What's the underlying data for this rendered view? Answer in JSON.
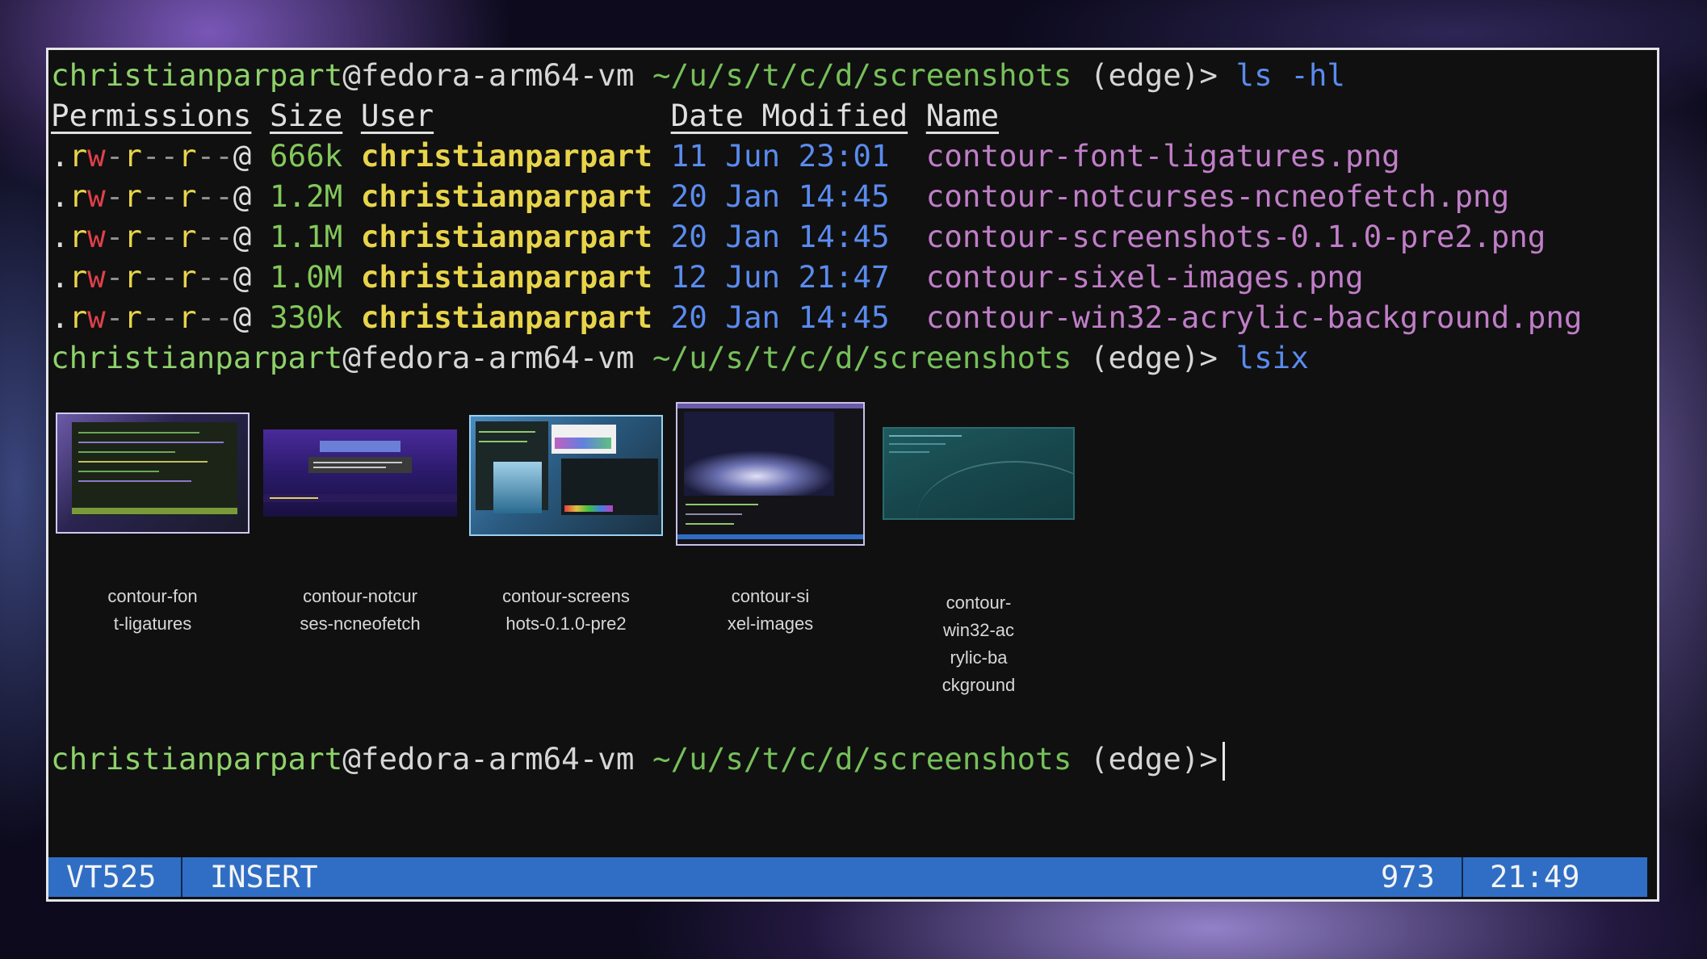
{
  "prompt": {
    "user_host": "christianparpart",
    "at_host": "@fedora-arm64-vm",
    "path": "~/u/s/t/c/d/screenshots",
    "branch": " (edge)>"
  },
  "commands": {
    "first": "ls -hl",
    "second": "lsix"
  },
  "listing": {
    "headers": {
      "permissions": "Permissions",
      "size": "Size",
      "user": "User",
      "date": "Date Modified",
      "name": "Name"
    },
    "rows": [
      {
        "size": "666k",
        "user": "christianparpart",
        "date": "11 Jun 23:01",
        "name": "contour-font-ligatures.png"
      },
      {
        "size": "1.2M",
        "user": "christianparpart",
        "date": "20 Jan 14:45",
        "name": "contour-notcurses-ncneofetch.png"
      },
      {
        "size": "1.1M",
        "user": "christianparpart",
        "date": "20 Jan 14:45",
        "name": "contour-screenshots-0.1.0-pre2.png"
      },
      {
        "size": "1.0M",
        "user": "christianparpart",
        "date": "12 Jun 21:47",
        "name": "contour-sixel-images.png"
      },
      {
        "size": "330k",
        "user": "christianparpart",
        "date": "20 Jan 14:45",
        "name": "contour-win32-acrylic-background.png"
      }
    ]
  },
  "thumbnails": [
    {
      "caption_lines": [
        "contour-fon",
        "t-ligatures"
      ]
    },
    {
      "caption_lines": [
        "contour-notcur",
        "ses-ncneofetch"
      ]
    },
    {
      "caption_lines": [
        "contour-screens",
        "hots-0.1.0-pre2"
      ]
    },
    {
      "caption_lines": [
        "contour-si",
        "xel-images"
      ]
    },
    {
      "caption_lines": [
        "contour-",
        "win32-ac",
        "rylic-ba",
        "ckground"
      ]
    }
  ],
  "statusbar": {
    "terminal": "VT525",
    "mode": "INSERT",
    "lines": "973",
    "clock": "21:49"
  },
  "colors": {
    "prompt_user": "#8ed16a",
    "command": "#5a8bef",
    "filename": "#c07ec8",
    "owner": "#e8d44a",
    "statusbar": "#2f6ec4"
  }
}
